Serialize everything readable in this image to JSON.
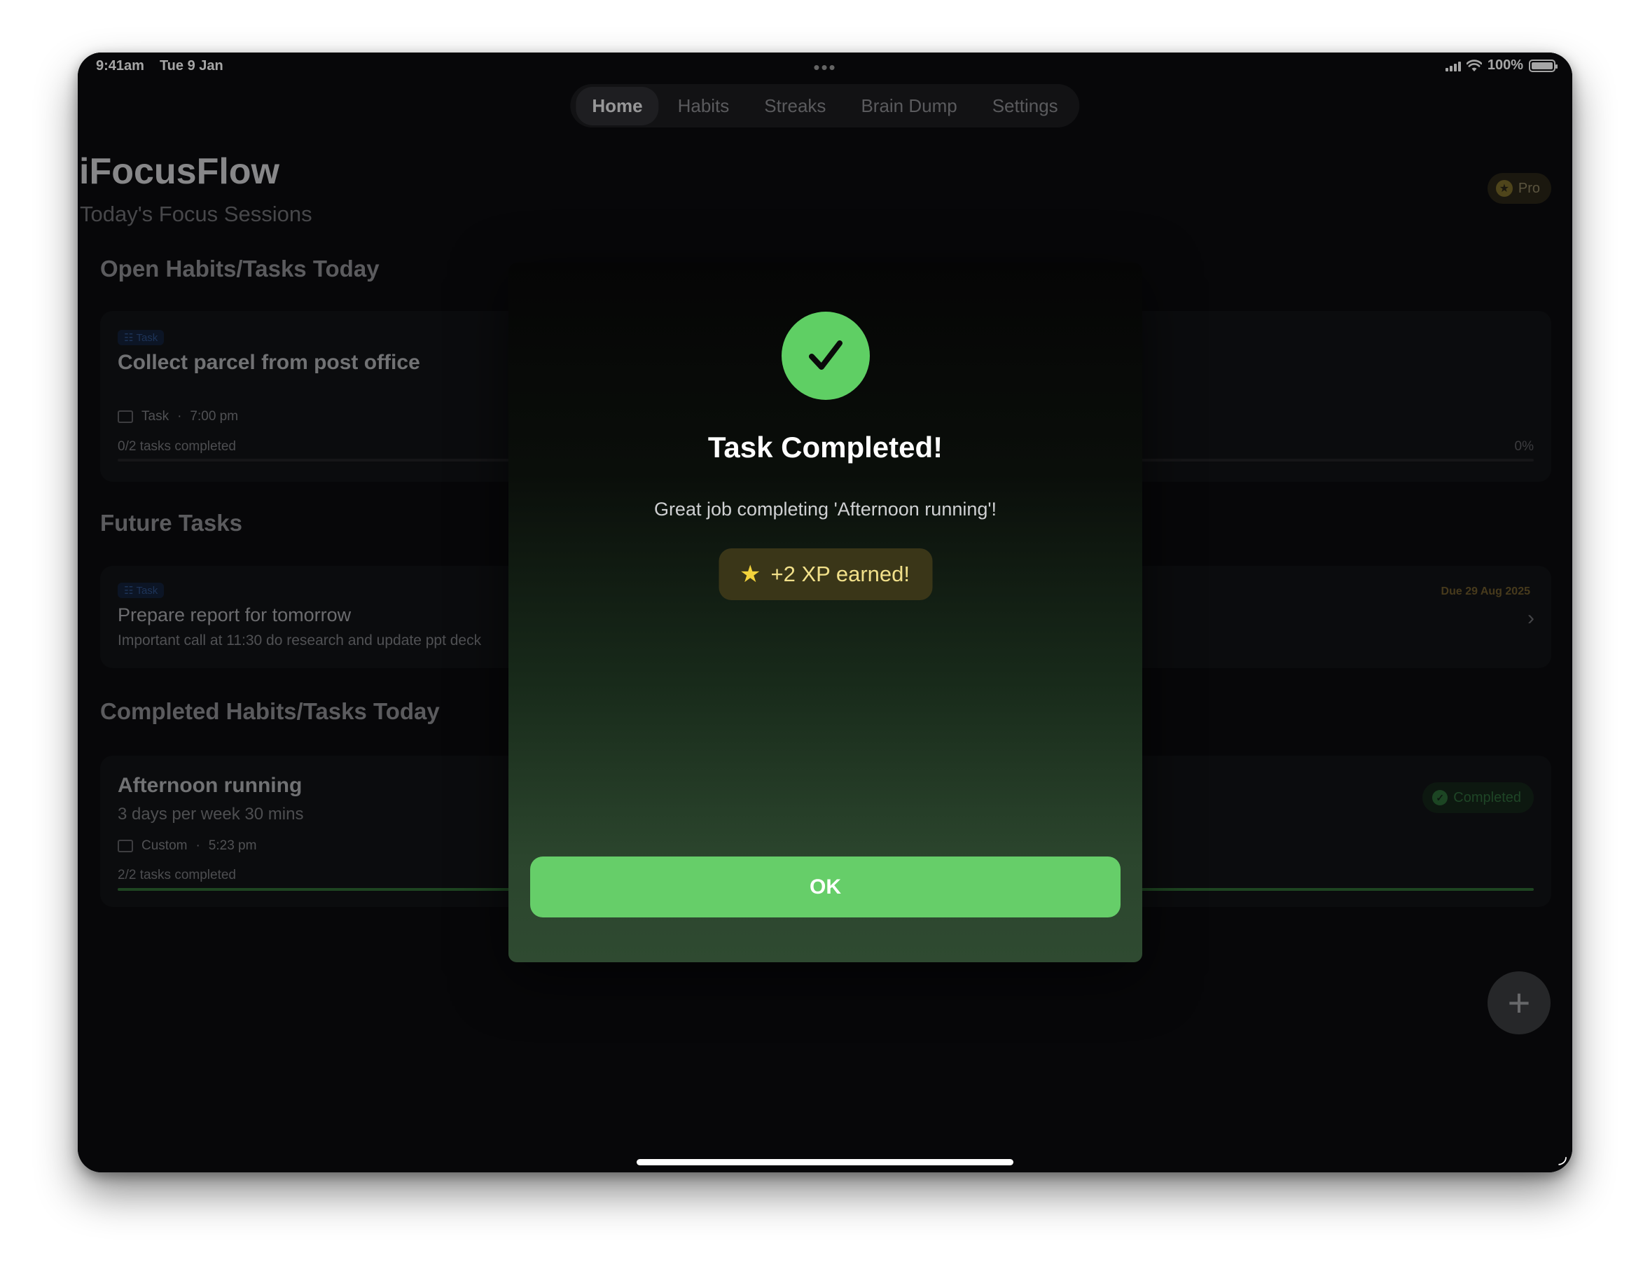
{
  "status_bar": {
    "time": "9:41am",
    "date": "Tue 9 Jan",
    "battery": "100%"
  },
  "tabs": [
    {
      "label": "Home",
      "active": true
    },
    {
      "label": "Habits"
    },
    {
      "label": "Streaks"
    },
    {
      "label": "Brain Dump"
    },
    {
      "label": "Settings"
    }
  ],
  "header": {
    "title": "iFocusFlow",
    "subtitle": "Today's Focus Sessions",
    "pro_label": "Pro"
  },
  "sections": {
    "open": "Open Habits/Tasks Today",
    "future": "Future Tasks",
    "completed": "Completed Habits/Tasks Today"
  },
  "open_task": {
    "chip": "Task",
    "title": "Collect parcel from post office",
    "type": "Task",
    "time": "7:00 pm",
    "progress_label": "0/2 tasks completed",
    "progress_pct": "0%",
    "progress_fraction": 0
  },
  "future_task": {
    "chip": "Task",
    "title": "Prepare report for tomorrow",
    "description": "Important call at 11:30 do research and update ppt deck",
    "due": "Due 29 Aug 2025"
  },
  "completed_task": {
    "title": "Afternoon running",
    "subtitle": "3 days per week 30 mins",
    "type": "Custom",
    "time": "5:23 pm",
    "progress_label": "2/2 tasks completed",
    "progress_fraction": 1,
    "badge": "Completed"
  },
  "modal": {
    "title": "Task Completed!",
    "message": "Great job completing 'Afternoon running'!",
    "xp": "+2 XP earned!",
    "ok_label": "OK"
  },
  "colors": {
    "accent_green": "#66ce69",
    "xp_gold": "#f3d33c",
    "background": "#0b0c0e"
  }
}
